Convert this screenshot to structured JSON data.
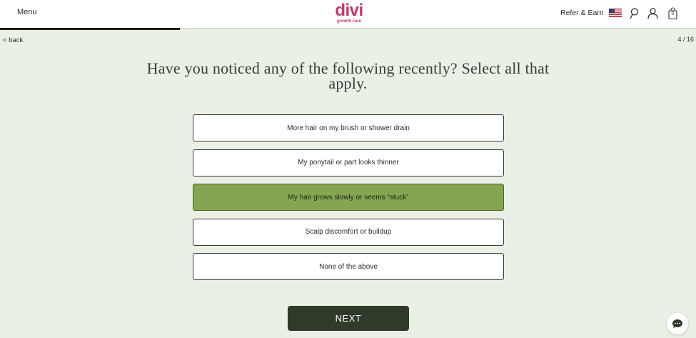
{
  "header": {
    "menu_label": "Menu",
    "logo_text": "divi",
    "logo_subtext": "growth care",
    "refer_label": "Refer & Earn",
    "flag_icon": "us-flag-icon",
    "search_icon": "search-icon",
    "account_icon": "account-icon",
    "cart_icon": "cart-icon",
    "cart_count": "0",
    "brand_color": "#c4376b"
  },
  "progress": {
    "fraction": 0.25
  },
  "nav": {
    "back_label": "< back",
    "step_label": "4 / 16"
  },
  "question": "Have you noticed any of the following recently? Select all that apply.",
  "options": [
    {
      "label": "More hair on my brush or shower drain",
      "selected": false
    },
    {
      "label": "My ponytail or part looks thinner",
      "selected": false
    },
    {
      "label": "My hair grows slowly or seems “stuck”",
      "selected": true
    },
    {
      "label": "Scalp discomfort or buildup",
      "selected": false
    },
    {
      "label": "None of the above",
      "selected": false
    }
  ],
  "next_label": "NEXT",
  "chat_icon": "chat-icon",
  "colors": {
    "background": "#e9f0e4",
    "selected": "#85a550",
    "button": "#2f3a2a"
  }
}
